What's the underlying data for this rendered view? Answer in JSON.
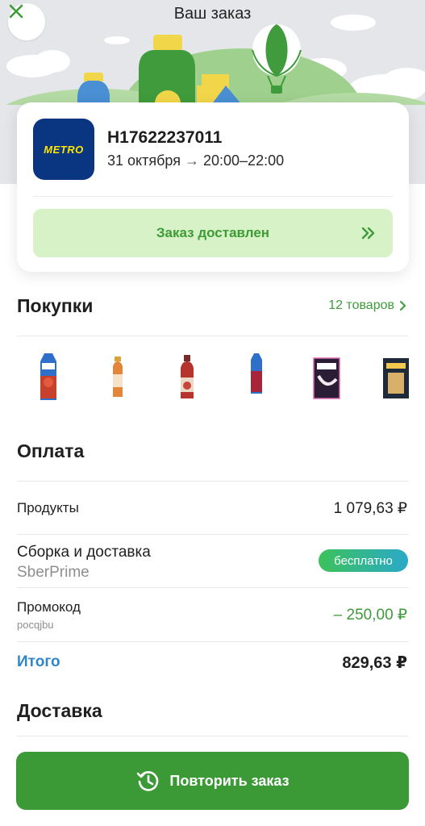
{
  "header": {
    "title": "Ваш заказ"
  },
  "order": {
    "store_logo_text": "METRO",
    "number": "H17622237011",
    "date": "31 октября",
    "time": "20:00–22:00",
    "status": "Заказ доставлен"
  },
  "purchases": {
    "title": "Покупки",
    "items_count": "12 товаров",
    "thumbnails": [
      {
        "icon": "juice-carton-icon",
        "color": "#c8402c"
      },
      {
        "icon": "juice-bottle-icon",
        "color": "#e2873a"
      },
      {
        "icon": "juice-bottle-icon",
        "color": "#b5342d"
      },
      {
        "icon": "juice-carton-icon",
        "color": "#a8243b"
      },
      {
        "icon": "cereal-box-icon",
        "color": "#2b1d35"
      },
      {
        "icon": "cereal-box-icon",
        "color": "#1e2a3a"
      }
    ]
  },
  "payment": {
    "title": "Оплата",
    "products_label": "Продукты",
    "products_value": "1 079,63 ₽",
    "delivery_label": "Сборка и доставка",
    "delivery_sub": "SberPrime",
    "delivery_value": "бесплатно",
    "promo_label": "Промокод",
    "promo_code": "pocqjbu",
    "promo_value": "– 250,00 ₽",
    "total_label": "Итого",
    "total_value": "829,63 ₽"
  },
  "delivery": {
    "title": "Доставка"
  },
  "actions": {
    "repeat_label": "Повторить заказ"
  },
  "colors": {
    "accent_green": "#3b9a36",
    "status_bg": "#d6f2c6",
    "total_blue": "#2f86c8",
    "metro_blue": "#0a3580",
    "metro_yellow": "#ffe600"
  }
}
